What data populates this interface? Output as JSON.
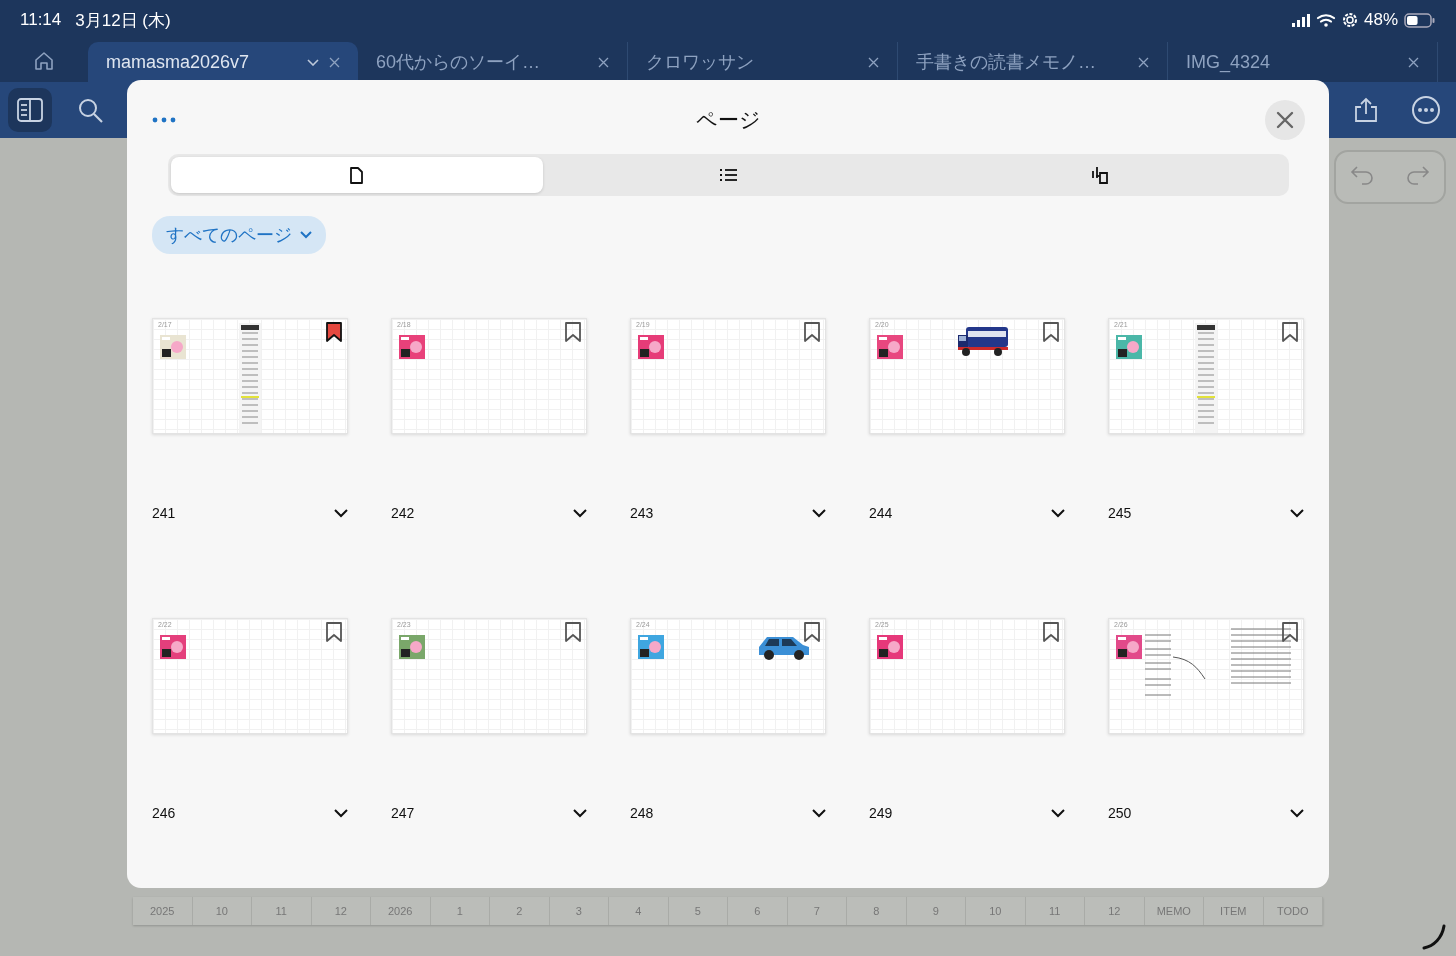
{
  "status_bar": {
    "time": "11:14",
    "date": "3月12日 (木)",
    "battery": "48%"
  },
  "tabs": [
    {
      "title": "mamasma2026v7",
      "selected": true,
      "menu": true
    },
    {
      "title": "60代からのソーイ…",
      "selected": false,
      "menu": false
    },
    {
      "title": "クロワッサン",
      "selected": false,
      "menu": false
    },
    {
      "title": "手書きの読書メモノ…",
      "selected": false,
      "menu": false
    },
    {
      "title": "IMG_4324",
      "selected": false,
      "menu": false
    }
  ],
  "modal": {
    "title": "ページ",
    "segments": [
      {
        "kind": "pages",
        "selected": true
      },
      {
        "kind": "outline",
        "selected": false
      },
      {
        "kind": "stamps",
        "selected": false
      }
    ],
    "filter": "すべてのページ",
    "pages": [
      {
        "number": "241",
        "date": "2/17",
        "bookmarked": true,
        "color": "#e9e4d2",
        "kind": "receipt"
      },
      {
        "number": "242",
        "date": "2/18",
        "bookmarked": false,
        "color": "#e8417a",
        "kind": "plain"
      },
      {
        "number": "243",
        "date": "2/19",
        "bookmarked": false,
        "color": "#e63c78",
        "kind": "plain"
      },
      {
        "number": "244",
        "date": "2/20",
        "bookmarked": false,
        "color": "#e8477f",
        "kind": "truck"
      },
      {
        "number": "245",
        "date": "2/21",
        "bookmarked": false,
        "color": "#4bb7a8",
        "kind": "receipt"
      },
      {
        "number": "246",
        "date": "2/22",
        "bookmarked": false,
        "color": "#e43f7c",
        "kind": "plain"
      },
      {
        "number": "247",
        "date": "2/23",
        "bookmarked": false,
        "color": "#7aa76a",
        "kind": "plain"
      },
      {
        "number": "248",
        "date": "2/24",
        "bookmarked": false,
        "color": "#3fa6e0",
        "kind": "car"
      },
      {
        "number": "249",
        "date": "2/25",
        "bookmarked": false,
        "color": "#e6387a",
        "kind": "plain"
      },
      {
        "number": "250",
        "date": "2/26",
        "bookmarked": false,
        "color": "#e24a8a",
        "kind": "notes"
      }
    ]
  },
  "index_tabs": [
    "2025",
    "10",
    "11",
    "12",
    "2026",
    "1",
    "2",
    "3",
    "4",
    "5",
    "6",
    "7",
    "8",
    "9",
    "10",
    "11",
    "12",
    "MEMO",
    "ITEM",
    "TODO"
  ]
}
